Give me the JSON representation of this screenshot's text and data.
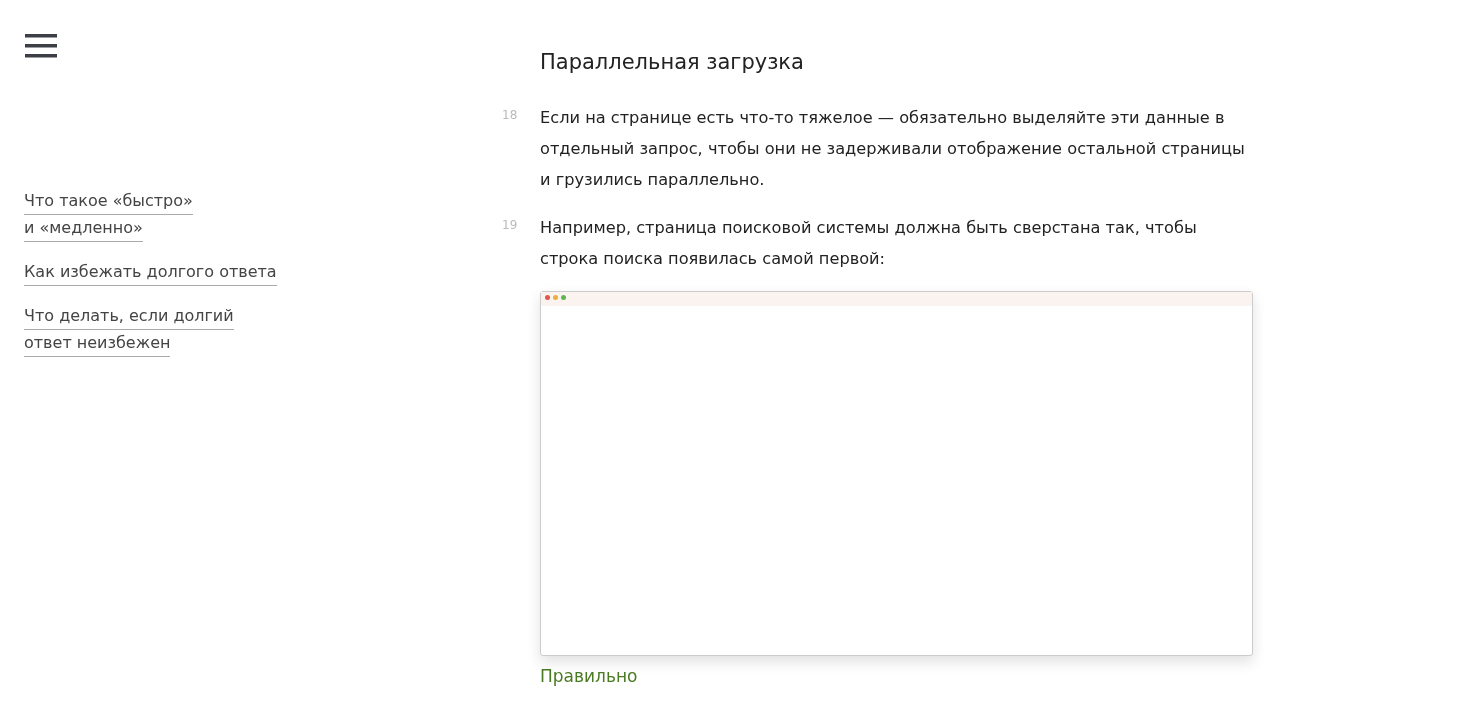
{
  "nav": {
    "links": [
      {
        "lines": [
          "Что такое «быстро»",
          "и «медленно»"
        ]
      },
      {
        "lines": [
          "Как избежать долгого ответа"
        ]
      },
      {
        "lines": [
          "Что делать, если долгий",
          "ответ неизбежен"
        ]
      }
    ]
  },
  "article": {
    "heading": "Параллельная загрузка",
    "paragraphs": [
      {
        "number": "18",
        "text": "Если на странице есть что-то тяжелое — обязательно выделяйте эти данные в отдельный запрос, чтобы они не задерживали отображение остальной страницы и грузились параллельно."
      },
      {
        "number": "19",
        "text": "Например, страница поисковой системы должна быть сверстана так, чтобы строка поиска появилась самой первой:"
      }
    ],
    "figure": {
      "caption": "Правильно"
    }
  }
}
